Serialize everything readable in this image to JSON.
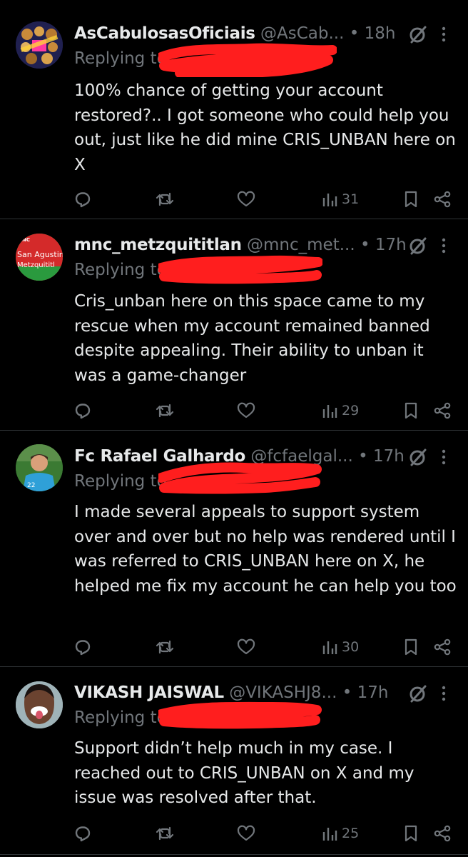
{
  "colors": {
    "background": "#000000",
    "text": "#e7e9ea",
    "secondary": "#71767b",
    "scribble": "#ff1e1e",
    "divider": "#2f3336"
  },
  "icons": [
    "reply-icon",
    "retweet-icon",
    "like-icon",
    "views-icon",
    "bookmark-icon",
    "share-icon",
    "grok-icon",
    "more-icon"
  ],
  "tweets": [
    {
      "display_name": "AsCabulosasOficiais",
      "handle": "@AsCab...",
      "separator": "•",
      "time": "18h",
      "replying_to": "Replying to",
      "text": "100% chance of getting your account restored?.. I got someone who could help you out, just like he did mine CRIS_UNBAN  here on X",
      "views": "31"
    },
    {
      "display_name": "mnc_metzquititlan",
      "handle": "@mnc_met...",
      "separator": "•",
      "time": "17h",
      "replying_to": "Replying to",
      "avatar_text_1": "San Agustin",
      "avatar_text_2": "Metzquititl",
      "avatar_text_3": "MNC",
      "text": "Cris_unban here on this space came to my rescue when my account remained banned despite appealing. Their ability to unban it was a game-changer",
      "views": "29"
    },
    {
      "display_name": "Fc Rafael Galhardo",
      "handle": "@fcfaelgal...",
      "separator": "•",
      "time": "17h",
      "replying_to": "Replying to",
      "avatar_text_1": "22",
      "text": "I made several appeals to support system over and over but no help was rendered until I was referred to CRIS_UNBAN here on X, he helped me fix my account he can help you too",
      "views": "30"
    },
    {
      "display_name": "VIKASH JAISWAL",
      "handle": "@VIKASHJ8...",
      "separator": "•",
      "time": "17h",
      "replying_to": "Replying to",
      "text": "Support didn’t help much in my case. I reached out to CRIS_UNBAN  on X and my issue was resolved after that.",
      "views": "25"
    }
  ]
}
